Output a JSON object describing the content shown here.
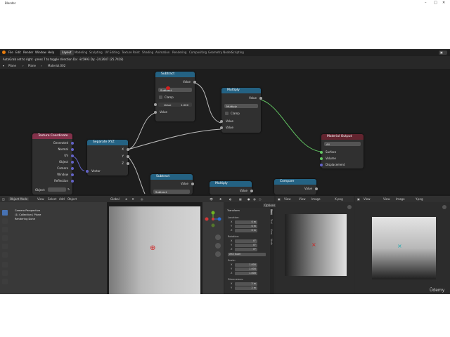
{
  "window": {
    "title": "Blender"
  },
  "menu": [
    "File",
    "Edit",
    "Render",
    "Window",
    "Help"
  ],
  "workspaces": [
    {
      "label": "Layout",
      "active": true
    },
    {
      "label": "Modeling",
      "active": false
    },
    {
      "label": "Sculpting",
      "active": false
    },
    {
      "label": "UV Editing",
      "active": false
    },
    {
      "label": "Texture Paint",
      "active": false
    },
    {
      "label": "Shading",
      "active": false
    },
    {
      "label": "Animation",
      "active": false
    },
    {
      "label": "Rendering",
      "active": false
    },
    {
      "label": "Compositing",
      "active": false
    },
    {
      "label": "Geometry Nodes",
      "active": false
    },
    {
      "label": "Scripting",
      "active": false
    }
  ],
  "status": {
    "text": "AutoGrab set to right · press T to toggle direction   Dx: -8.5993   Dy: -24.2647 (25.7418)"
  },
  "breadcrumb": {
    "object": "Plane",
    "mesh": "Plane",
    "material": "Material.002"
  },
  "nodes": {
    "subtract1": {
      "title": "Subtract",
      "out": "Value",
      "op": "Subtract",
      "clamp": "Clamp",
      "field_label": "Value",
      "field_value": "1.000",
      "in": "Value"
    },
    "multiply1": {
      "title": "Multiply",
      "out": "Value",
      "op": "Multiply",
      "clamp": "Clamp",
      "in1": "Value",
      "in2": "Value"
    },
    "texcoord": {
      "title": "Texture Coordinate",
      "outputs": [
        "Generated",
        "Normal",
        "UV",
        "Object",
        "Camera",
        "Window",
        "Reflection"
      ],
      "object_label": "Object:"
    },
    "separate": {
      "title": "Separate XYZ",
      "outputs": [
        "X",
        "Y",
        "Z"
      ],
      "in": "Vector"
    },
    "matout": {
      "title": "Material Output",
      "target": "All",
      "inputs": [
        "Surface",
        "Volume",
        "Displacement"
      ]
    },
    "subtract2": {
      "title": "Subtract",
      "out": "Value",
      "op": "Subtract"
    },
    "multiply2": {
      "title": "Multiply",
      "out": "Value"
    },
    "compare": {
      "title": "Compare",
      "out": "Value"
    }
  },
  "viewport": {
    "mode": "Object Mode",
    "menu": [
      "View",
      "Select",
      "Add",
      "Object"
    ],
    "transform_space": "Global",
    "info": [
      "Camera Perspective",
      "(1) Collection | Plane",
      "Rendering Done"
    ],
    "options_label": "Options"
  },
  "nprops": {
    "section": "Transform",
    "location_label": "Location:",
    "location": [
      {
        "axis": "X",
        "value": "0 m"
      },
      {
        "axis": "Y",
        "value": "0 m"
      },
      {
        "axis": "Z",
        "value": "0 m"
      }
    ],
    "rotation_label": "Rotation:",
    "rotation": [
      {
        "axis": "X",
        "value": "0°"
      },
      {
        "axis": "Y",
        "value": "0°"
      },
      {
        "axis": "Z",
        "value": "0°"
      }
    ],
    "rotation_mode": "XYZ Euler",
    "scale_label": "Scale:",
    "scale": [
      {
        "axis": "X",
        "value": "1.000"
      },
      {
        "axis": "Y",
        "value": "1.000"
      },
      {
        "axis": "Z",
        "value": "1.000"
      }
    ],
    "dimensions_label": "Dimensions:",
    "dimensions": [
      {
        "axis": "X",
        "value": "2 m"
      },
      {
        "axis": "Y",
        "value": "2 m"
      }
    ],
    "tabs": [
      "Item",
      "Tool",
      "View",
      "Node"
    ]
  },
  "image1": {
    "menu": [
      "View",
      "View",
      "Image"
    ],
    "name": "X.png"
  },
  "image2": {
    "menu": [
      "View",
      "View",
      "Image"
    ],
    "name": "Y.png"
  },
  "watermark": "Ûdemy",
  "colors": {
    "math": "#246283",
    "texture": "#83314a",
    "output": "#63242f",
    "accent": "#4772b3"
  }
}
